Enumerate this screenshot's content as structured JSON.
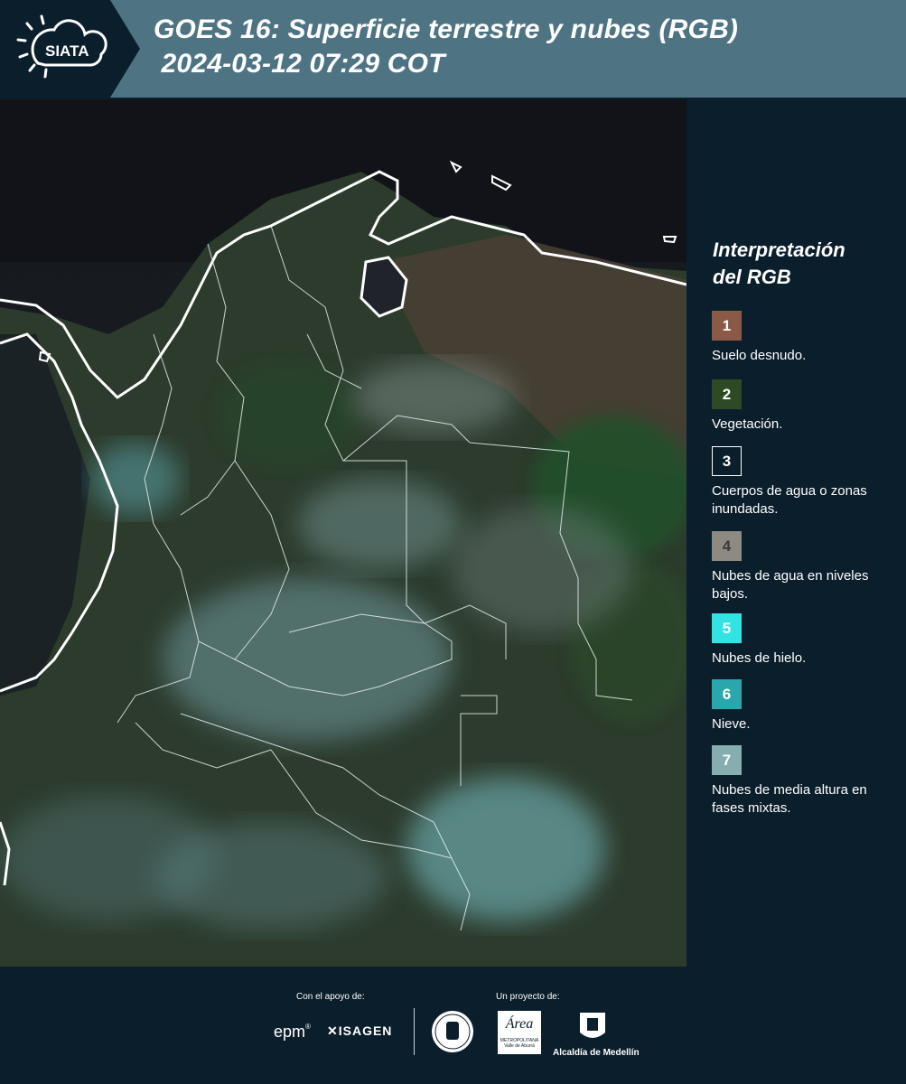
{
  "header": {
    "logo_text": "SIATA",
    "title_line1": "GOES 16: Superficie terrestre y nubes (RGB)",
    "title_line2": " 2024-03-12 07:29 COT"
  },
  "legend": {
    "title_line1": "Interpretación",
    "title_line2": "del RGB",
    "items": [
      {
        "num": "1",
        "label": "Suelo desnudo.",
        "color": "#8a5a46",
        "text_color": "#ffffff"
      },
      {
        "num": "2",
        "label": "Vegetación.",
        "color": "#2e4a25",
        "text_color": "#ffffff"
      },
      {
        "num": "3",
        "label": "Cuerpos de agua o zonas inundadas.",
        "color": "#0b1e2b",
        "text_color": "#ffffff"
      },
      {
        "num": "4",
        "label": "Nubes de agua en niveles bajos.",
        "color": "#8d8a82",
        "text_color": "#3a3a3a"
      },
      {
        "num": "5",
        "label": "Nubes de hielo.",
        "color": "#33e3e3",
        "text_color": "#ffffff"
      },
      {
        "num": "6",
        "label": "Nieve.",
        "color": "#2aa6ad",
        "text_color": "#ffffff"
      },
      {
        "num": "7",
        "label": "Nubes de media altura en fases mixtas.",
        "color": "#86aeb0",
        "text_color": "#ffffff"
      }
    ]
  },
  "footer": {
    "support_label": "Con el apoyo de:",
    "project_label": "Un proyecto de:",
    "sponsor_epm": "epm",
    "sponsor_isagen": "ISAGEN",
    "area_label": "Área",
    "area_sub": "METROPOLITANA",
    "area_sub2": "Valle de Aburrá",
    "alcaldia": "Alcaldía de Medellín"
  }
}
